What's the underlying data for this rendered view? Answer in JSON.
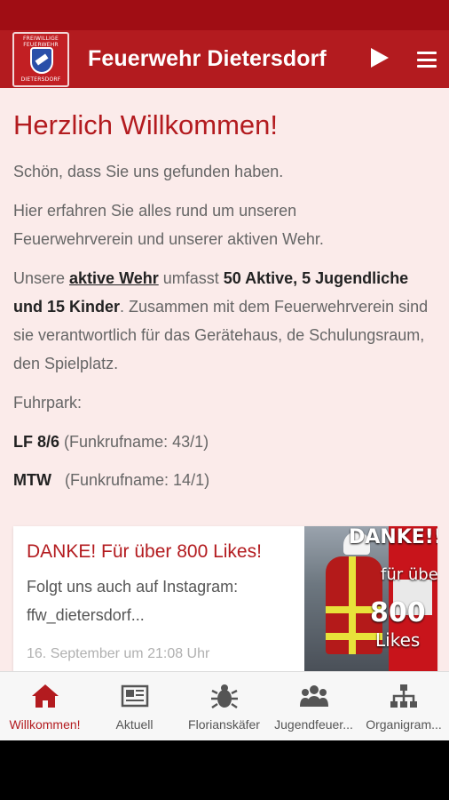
{
  "app": {
    "title": "Feuerwehr Dietersdorf",
    "logo_text_top": "FREIWILLIGE FEUERWEHR",
    "logo_text_bottom": "DIETERSDORF"
  },
  "content": {
    "welcome": "Herzlich Willkommen!",
    "p1": "Schön, dass Sie uns gefunden haben.",
    "p2_line1": "Hier erfahren Sie alles rund um unseren",
    "p2_line2": "Feuerwehrverein und unserer aktiven Wehr.",
    "p3_prefix": "Unsere ",
    "p3_link": "aktive Wehr",
    "p3_mid": " umfasst ",
    "p3_bold": "50 Aktive, 5 Jugendliche und 15 Kinder",
    "p3_rest": ". Zusammen mit dem Feuerwehrverein sind sie verantwortlich für das Gerätehaus, de Schulungsraum, den Spielplatz.",
    "fuhrpark_label": "Fuhrpark:",
    "vehicle1_name": "LF 8/6",
    "vehicle1_callsign": "(Funkrufname: 43/1)",
    "vehicle2_name": "MTW",
    "vehicle2_callsign": "(Funkrufname: 14/1)"
  },
  "news_card": {
    "title": "DANKE! Für über 800 Likes!",
    "text": "Folgt uns auch auf Instagram: ffw_dietersdorf...",
    "date": "16. September um 21:08 Uhr",
    "image_text_1": "DANKE!!!",
    "image_text_2": "für über",
    "image_text_3": "800",
    "image_text_4": "Likes"
  },
  "bottom_nav": [
    {
      "label": "Willkommen!",
      "icon": "home-icon",
      "active": true
    },
    {
      "label": "Aktuell",
      "icon": "newspaper-icon",
      "active": false
    },
    {
      "label": "Florianskäfer",
      "icon": "beetle-icon",
      "active": false
    },
    {
      "label": "Jugendfeuer...",
      "icon": "group-icon",
      "active": false
    },
    {
      "label": "Organigram...",
      "icon": "org-chart-icon",
      "active": false
    }
  ],
  "colors": {
    "primary": "#b31b1f",
    "status_bar": "#a00d14",
    "content_bg": "#fbebea"
  }
}
